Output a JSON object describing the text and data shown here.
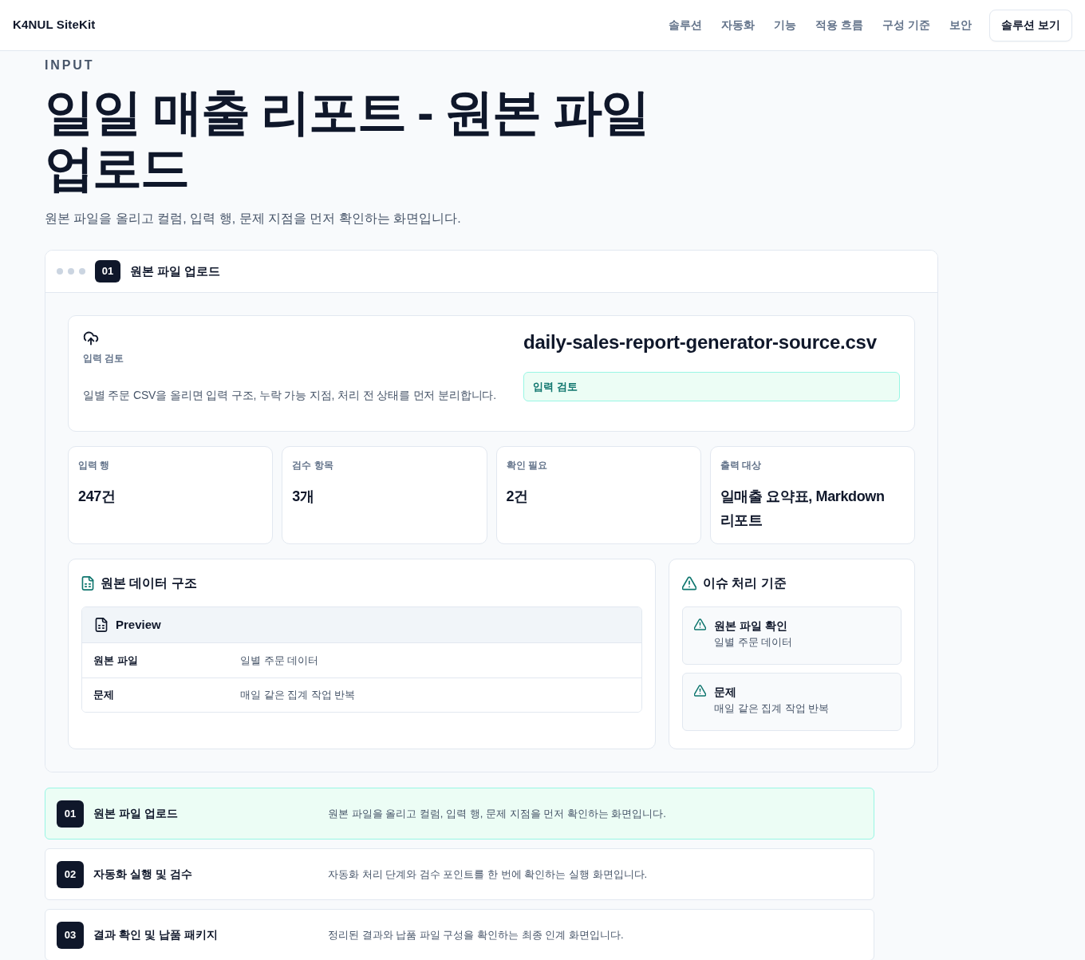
{
  "header": {
    "logo": "K4NUL SiteKit",
    "nav": [
      "솔루션",
      "자동화",
      "기능",
      "적용 흐름",
      "구성 기준",
      "보안"
    ],
    "cta": "솔루션 보기"
  },
  "hero": {
    "eyebrow": "INPUT",
    "title": "일일 매출 리포트 - 원본 파일 업로드",
    "subtitle": "원본 파일을 올리고 컬럼, 입력 행, 문제 지점을 먼저 확인하는 화면입니다."
  },
  "panel": {
    "step_number": "01",
    "title": "원본 파일 업로드",
    "upload": {
      "label": "입력 검토",
      "description": "일별 주문 CSV을 올리면 입력 구조, 누락 가능 지점, 처리 전 상태를 먼저 분리합니다.",
      "filename": "daily-sales-report-generator-source.csv",
      "status": "입력 검토"
    },
    "stats": [
      {
        "label": "입력 행",
        "value": "247건"
      },
      {
        "label": "검수 항목",
        "value": "3개"
      },
      {
        "label": "확인 필요",
        "value": "2건"
      },
      {
        "label": "출력 대상",
        "value": "일매출 요약표, Markdown 리포트"
      }
    ],
    "structure": {
      "title": "원본 데이터 구조",
      "preview_title": "Preview",
      "rows": [
        {
          "key": "원본 파일",
          "value": "일별 주문 데이터"
        },
        {
          "key": "문제",
          "value": "매일 같은 집계 작업 반복"
        }
      ]
    },
    "issues": {
      "title": "이슈 처리 기준",
      "items": [
        {
          "title": "원본 파일 확인",
          "detail": "일별 주문 데이터"
        },
        {
          "title": "문제",
          "detail": "매일 같은 집계 작업 반복"
        }
      ]
    }
  },
  "steps": [
    {
      "number": "01",
      "title": "원본 파일 업로드",
      "description": "원본 파일을 올리고 컬럼, 입력 행, 문제 지점을 먼저 확인하는 화면입니다.",
      "selected": true
    },
    {
      "number": "02",
      "title": "자동화 실행 및 검수",
      "description": "자동화 처리 단계와 검수 포인트를 한 번에 확인하는 실행 화면입니다.",
      "selected": false
    },
    {
      "number": "03",
      "title": "결과 확인 및 납품 패키지",
      "description": "정리된 결과와 납품 파일 구성을 확인하는 최종 인계 화면입니다.",
      "selected": false
    }
  ]
}
